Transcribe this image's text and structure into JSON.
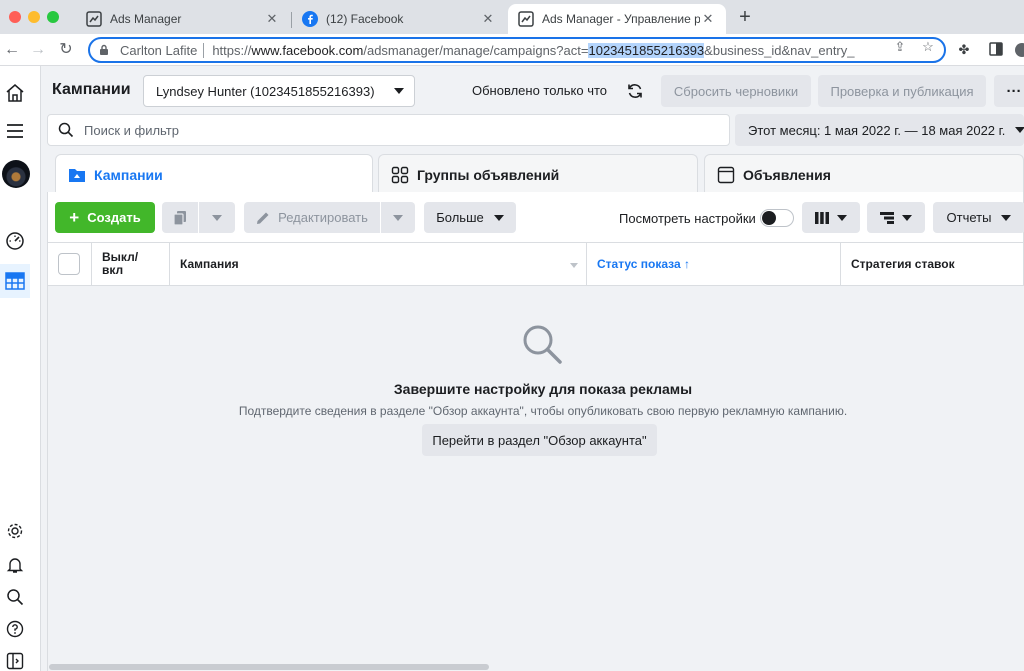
{
  "browser": {
    "tabs": [
      {
        "title": "Ads Manager",
        "close": "✕"
      },
      {
        "title": "(12) Facebook",
        "close": "✕"
      },
      {
        "title": "Ads Manager - Управление ре",
        "close": "✕"
      }
    ],
    "new_tab": "+",
    "profile": "Carlton Lafite",
    "url_prefix": "https://",
    "url_host": "www.facebook.com",
    "url_path": "/adsmanager/manage/campaigns?act=",
    "url_selected": "1023451855216393",
    "url_rest": "&business_id&nav_entry_"
  },
  "header": {
    "title": "Кампании",
    "account": "Lyndsey Hunter (1023451855216393)",
    "updated": "Обновлено только что",
    "reset_drafts": "Сбросить черновики",
    "review_publish": "Проверка и публикация",
    "more": "···"
  },
  "search": {
    "placeholder": "Поиск и фильтр",
    "date_range": "Этот месяц: 1 мая 2022 г. — 18 мая 2022 г."
  },
  "level_tabs": [
    {
      "label": "Кампании"
    },
    {
      "label": "Группы объявлений"
    },
    {
      "label": "Объявления"
    }
  ],
  "toolbar": {
    "create": "Создать",
    "edit": "Редактировать",
    "more": "Больше",
    "view_settings": "Посмотреть настройки",
    "reports": "Отчеты"
  },
  "table": {
    "columns": [
      "Выкл/\nвкл",
      "Кампания",
      "Статус показа ↑",
      "Стратегия ставок"
    ]
  },
  "empty_state": {
    "title": "Завершите настройку для показа рекламы",
    "description": "Подтвердите сведения в разделе \"Обзор аккаунта\", чтобы опубликовать свою первую рекламную кампанию.",
    "button": "Перейти в раздел \"Обзор аккаунта\""
  },
  "colors": {
    "accent": "#1877f2",
    "create_green": "#42b72a",
    "selection": "#b3d4fc"
  }
}
